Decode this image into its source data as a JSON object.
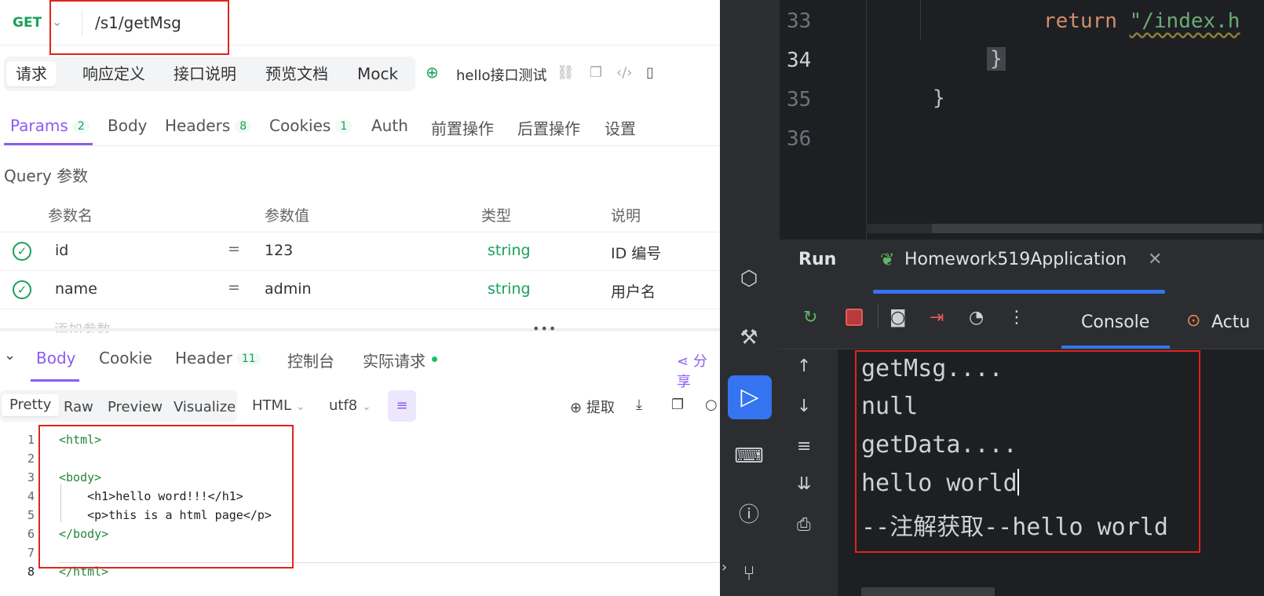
{
  "request": {
    "method": "GET",
    "path": "/s1/getMsg"
  },
  "main_tabs": [
    "请求",
    "响应定义",
    "接口说明",
    "预览文档",
    "Mock"
  ],
  "api_name": "hello接口测试",
  "param_tabs": [
    {
      "label": "Params",
      "count": "2"
    },
    {
      "label": "Body",
      "count": ""
    },
    {
      "label": "Headers",
      "count": "8"
    },
    {
      "label": "Cookies",
      "count": "1"
    },
    {
      "label": "Auth",
      "count": ""
    },
    {
      "label": "前置操作",
      "count": ""
    },
    {
      "label": "后置操作",
      "count": ""
    },
    {
      "label": "设置",
      "count": ""
    }
  ],
  "query_section": "Query 参数",
  "table_headers": [
    "参数名",
    "参数值",
    "类型",
    "说明"
  ],
  "params": [
    {
      "name": "id",
      "eq": "=",
      "value": "123",
      "type": "string",
      "desc": "ID 编号"
    },
    {
      "name": "name",
      "eq": "=",
      "value": "admin",
      "type": "string",
      "desc": "用户名"
    }
  ],
  "add_param_placeholder": "添加参数",
  "response_tabs": [
    {
      "label": "Body",
      "count": ""
    },
    {
      "label": "Cookie",
      "count": ""
    },
    {
      "label": "Header",
      "count": "11"
    },
    {
      "label": "控制台",
      "count": ""
    },
    {
      "label": "实际请求",
      "count": ""
    }
  ],
  "share_label": "分享",
  "view_modes": [
    "Pretty",
    "Raw",
    "Preview",
    "Visualize"
  ],
  "format_select": "HTML",
  "encoding_select": "utf8",
  "extract_label": "提取",
  "code_lines": [
    {
      "n": "1",
      "text": "<html>"
    },
    {
      "n": "2",
      "text": ""
    },
    {
      "n": "3",
      "text": "<body>"
    },
    {
      "n": "4",
      "text": "    <h1>hello word!!!</h1>"
    },
    {
      "n": "5",
      "text": "    <p>this is a html page</p>"
    },
    {
      "n": "6",
      "text": "</body>"
    },
    {
      "n": "7",
      "text": ""
    },
    {
      "n": "8",
      "text": "</html>"
    }
  ],
  "editor": {
    "line_numbers": [
      "33",
      "34",
      "35",
      "36"
    ],
    "line33_keyword": "return",
    "line33_string": "\"/index.h",
    "line34": "}",
    "line35": "}"
  },
  "run_panel": {
    "title": "Run",
    "app_tab": "Homework519Application",
    "console_tab": "Console",
    "actuator_tab": "Actu",
    "output": [
      "getMsg....",
      "null",
      "getData....",
      "hello world",
      "--注解获取--hello world"
    ]
  },
  "colors": {
    "accent_purple": "#8a5cf5",
    "method_green": "#19a05a",
    "highlight_red": "#e0241c",
    "ide_blue": "#3574f0"
  }
}
